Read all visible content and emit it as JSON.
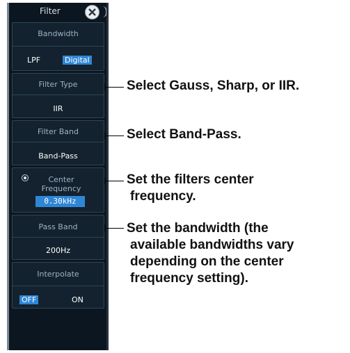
{
  "panel": {
    "title": "Filter",
    "close_icon": "close-x-icon",
    "bandwidth": {
      "label": "Bandwidth",
      "option_off": "LPF",
      "option_on": "Digital"
    },
    "filter_type": {
      "label": "Filter Type",
      "value": "IIR"
    },
    "filter_band": {
      "label": "Filter Band",
      "value": "Band-Pass"
    },
    "center_frequency": {
      "label_line1": "Center",
      "label_line2": "Frequency",
      "value": "0.30kHz"
    },
    "pass_band": {
      "label": "Pass Band",
      "value": "200Hz"
    },
    "interpolate": {
      "label": "Interpolate",
      "option_on": "OFF",
      "option_off": "ON"
    }
  },
  "annotations": {
    "filter_type": "Select Gauss, Sharp, or IIR.",
    "filter_band": "Select Band-Pass.",
    "center_frequency": [
      "Set the filters center",
      "frequency."
    ],
    "pass_band": [
      "Set the bandwidth (the",
      "available bandwidths vary",
      "depending on the center",
      "frequency setting)."
    ]
  },
  "colors": {
    "panel_bg": "#0c1620",
    "block_bg": "#13222e",
    "accent": "#2f86d6"
  }
}
